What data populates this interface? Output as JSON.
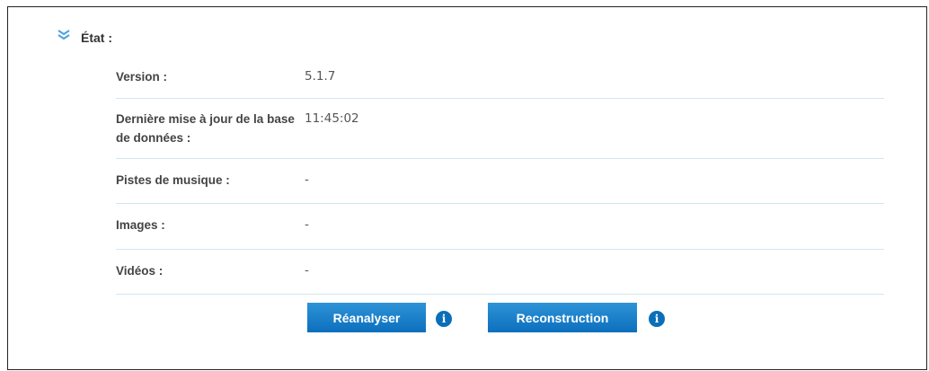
{
  "section": {
    "title": "État :"
  },
  "status_rows": [
    {
      "label": "Version :",
      "value": "5.1.7"
    },
    {
      "label": "Dernière mise à jour de la base de données :",
      "value": "11:45:02"
    },
    {
      "label": "Pistes de musique :",
      "value": "-"
    },
    {
      "label": "Images :",
      "value": "-"
    },
    {
      "label": "Vidéos :",
      "value": "-"
    }
  ],
  "actions": {
    "rescan_label": "Réanalyser",
    "rebuild_label": "Reconstruction",
    "info_icon": "info-icon"
  },
  "colors": {
    "accent": "#0b6fbd",
    "divider": "#cfe8f2",
    "chevron": "#4aa3df"
  }
}
